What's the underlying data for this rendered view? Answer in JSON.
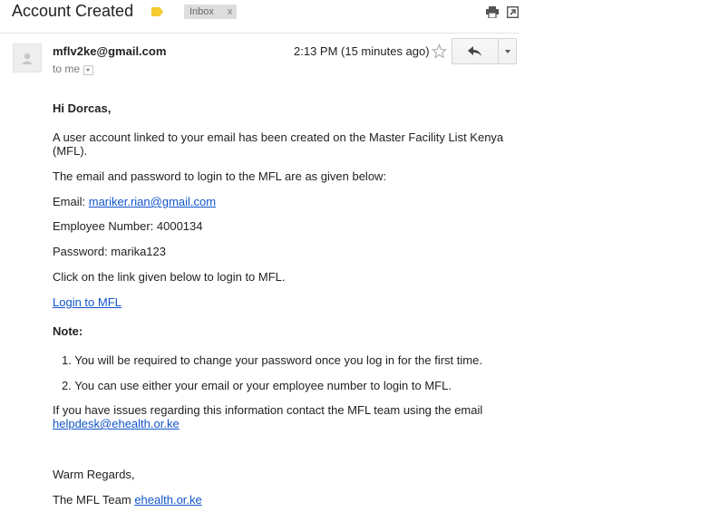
{
  "subject": "Account Created",
  "label_chip": {
    "text": "Inbox",
    "remove": "x"
  },
  "colors": {
    "label_tag": "#f4cb30",
    "link": "#1155cc"
  },
  "header": {
    "icons": [
      "print-icon",
      "open-new-window-icon"
    ]
  },
  "message": {
    "sender": "mflv2ke@gmail.com",
    "to": "to me",
    "timestamp": "2:13 PM (15 minutes ago)",
    "icons": [
      "avatar-placeholder-icon",
      "star-icon",
      "reply-icon",
      "more-options-dropdown-icon"
    ]
  },
  "body": {
    "greeting": "Hi Dorcas,",
    "intro_line1": "A user account linked to your email has been created on the Master Facility List Kenya",
    "intro_line2": "(MFL).",
    "credentials_intro": "The email and password to login to the MFL are as given below:",
    "email_label": "Email: ",
    "email_value": "mariker.rian@gmail.com",
    "employee_number": "Employee Number: 4000134",
    "password": "Password: marika123",
    "click_text": "Click on the link given below to login to MFL.",
    "login_link": "Login to MFL",
    "note_heading": "Note:",
    "notes": [
      "1. You will be required to change your password once you log in for the first time.",
      "2. You can use either your email or your employee number to login to MFL."
    ],
    "issues_text": "If you have issues regarding this information contact the MFL team using the email",
    "helpdesk_email": "helpdesk@ehealth.or.ke",
    "regards": "Warm Regards,",
    "team_text": "The MFL Team ",
    "team_link": "ehealth.or.ke"
  }
}
